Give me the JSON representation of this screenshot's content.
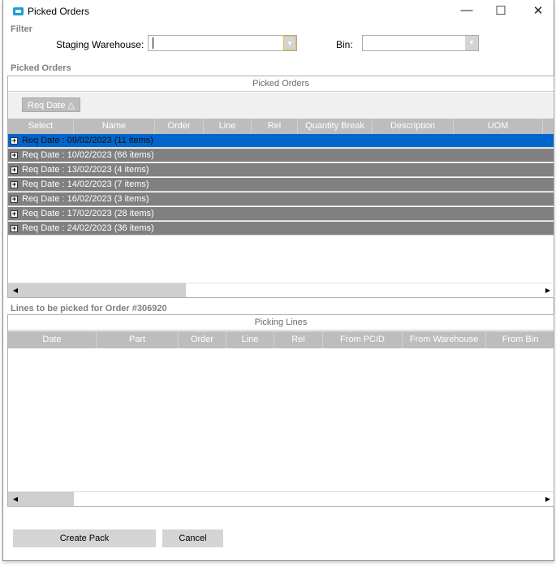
{
  "window": {
    "title": "Picked Orders",
    "minimize": "—",
    "maximize": "☐",
    "close": "✕"
  },
  "filter": {
    "section": "Filter",
    "staging_label": "Staging Warehouse:",
    "staging_value": "",
    "bin_label": "Bin:",
    "bin_value": "",
    "dropdown_glyph": "▼"
  },
  "picked": {
    "section": "Picked Orders",
    "grid_title": "Picked Orders",
    "group_chip": "Req Date",
    "group_sort_glyph": "△",
    "columns": [
      "Select",
      "Name",
      "Order",
      "Line",
      "Rel",
      "Quantity Break",
      "Description",
      "UOM",
      ""
    ],
    "groups": [
      "Req Date : 09/02/2023 (11 items)",
      "Req Date : 10/02/2023 (66 items)",
      "Req Date : 13/02/2023 (4 items)",
      "Req Date : 14/02/2023 (7 items)",
      "Req Date : 16/02/2023 (3 items)",
      "Req Date : 17/02/2023 (28 items)",
      "Req Date : 24/02/2023 (36 items)"
    ],
    "selected_index": 0
  },
  "lines": {
    "section": "Lines to be picked for Order #306920",
    "grid_title": "Picking Lines",
    "columns": [
      "Date",
      "Part",
      "Order",
      "Line",
      "Rel",
      "From PCID",
      "From Warehouse",
      "From Bin"
    ]
  },
  "scroll": {
    "left": "◀",
    "right": "▶"
  },
  "buttons": {
    "create": "Create Pack",
    "cancel": "Cancel"
  },
  "colors": {
    "selected": "#0066cc",
    "group_row": "#808080",
    "header": "#bdbdbd"
  }
}
